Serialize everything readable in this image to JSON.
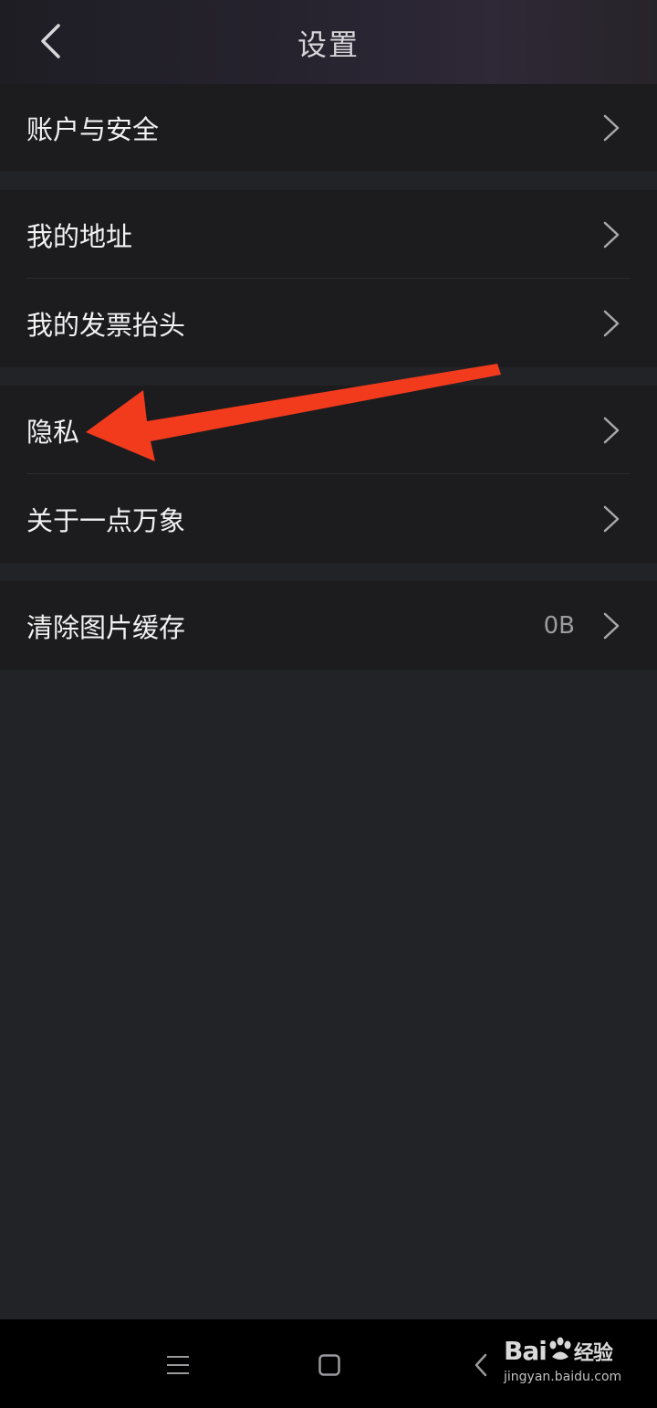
{
  "header": {
    "title": "设置"
  },
  "groups": [
    {
      "items": [
        {
          "label": "账户与安全"
        }
      ]
    },
    {
      "items": [
        {
          "label": "我的地址"
        },
        {
          "label": "我的发票抬头"
        }
      ]
    },
    {
      "items": [
        {
          "label": "隐私"
        },
        {
          "label": "关于一点万象"
        }
      ]
    },
    {
      "items": [
        {
          "label": "清除图片缓存",
          "value": "0B"
        }
      ]
    }
  ],
  "annotation": {
    "color": "#f23a1d",
    "target": "隐私"
  },
  "navbar": {
    "icons": [
      "menu-icon",
      "home-icon",
      "back-icon"
    ]
  },
  "watermark": {
    "logo_a": "Bai",
    "logo_b": "经验",
    "url": "jingyan.baidu.com"
  }
}
